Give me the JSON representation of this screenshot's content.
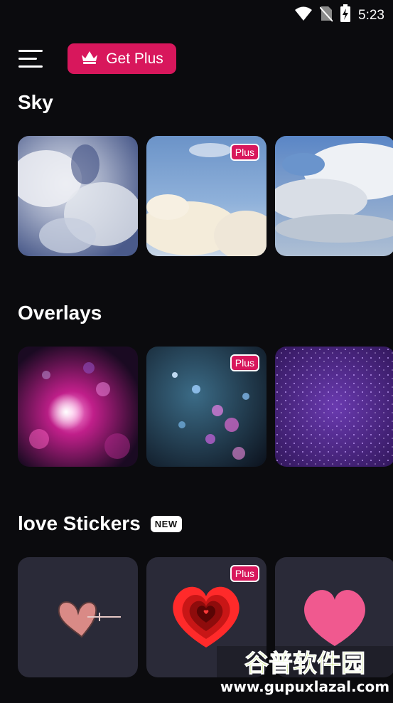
{
  "status": {
    "time": "5:23"
  },
  "header": {
    "menu_icon": "hamburger-menu-icon",
    "plus_button_label": "Get Plus",
    "plus_icon": "crown-icon"
  },
  "sections": [
    {
      "title": "Sky",
      "tiles": [
        {
          "badge": ""
        },
        {
          "badge": "Plus"
        },
        {
          "badge": ""
        }
      ]
    },
    {
      "title": "Overlays",
      "tiles": [
        {
          "badge": ""
        },
        {
          "badge": "Plus"
        },
        {
          "badge": ""
        }
      ]
    },
    {
      "title": "love Stickers",
      "new_badge": "NEW",
      "tiles": [
        {
          "badge": ""
        },
        {
          "badge": "Plus"
        },
        {
          "badge": ""
        }
      ]
    }
  ],
  "watermark": {
    "title": "谷普软件园",
    "url": "www.gupuxlazal.com"
  },
  "colors": {
    "accent": "#d8175c",
    "background": "#0b0b0e",
    "sticker_tile": "#2a2a38"
  }
}
